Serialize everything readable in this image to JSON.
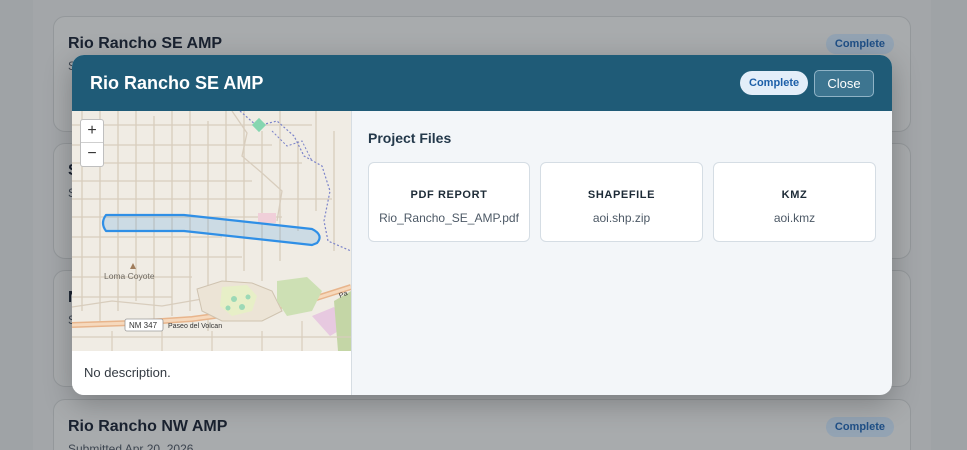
{
  "background": {
    "cards": [
      {
        "title": "Rio Rancho SE AMP",
        "status": "Complete",
        "sub_fragment": "S"
      },
      {
        "letter": "S",
        "sub_fragment": "S"
      },
      {
        "letter": "N",
        "sub_fragment": "S"
      },
      {
        "title": "Rio Rancho NW AMP",
        "submitted": "Submitted Apr 20, 2026",
        "status": "Complete"
      }
    ]
  },
  "modal": {
    "title": "Rio Rancho SE AMP",
    "status": "Complete",
    "close_label": "Close",
    "description": "No description.",
    "map": {
      "zoom_in": "+",
      "zoom_out": "−",
      "labels": {
        "loma_coyote": "Loma Coyote",
        "route": "NM 347",
        "road": "Paseo del Volcan",
        "pa": "Pa"
      }
    },
    "files_title": "Project Files",
    "files": [
      {
        "type": "PDF REPORT",
        "name": "Rio_Rancho_SE_AMP.pdf"
      },
      {
        "type": "SHAPEFILE",
        "name": "aoi.shp.zip"
      },
      {
        "type": "KMZ",
        "name": "aoi.kmz"
      }
    ]
  },
  "colors": {
    "header": "#1f5b77",
    "badge_text": "#1d5fa8",
    "aoi_stroke": "#2f8fe6"
  }
}
